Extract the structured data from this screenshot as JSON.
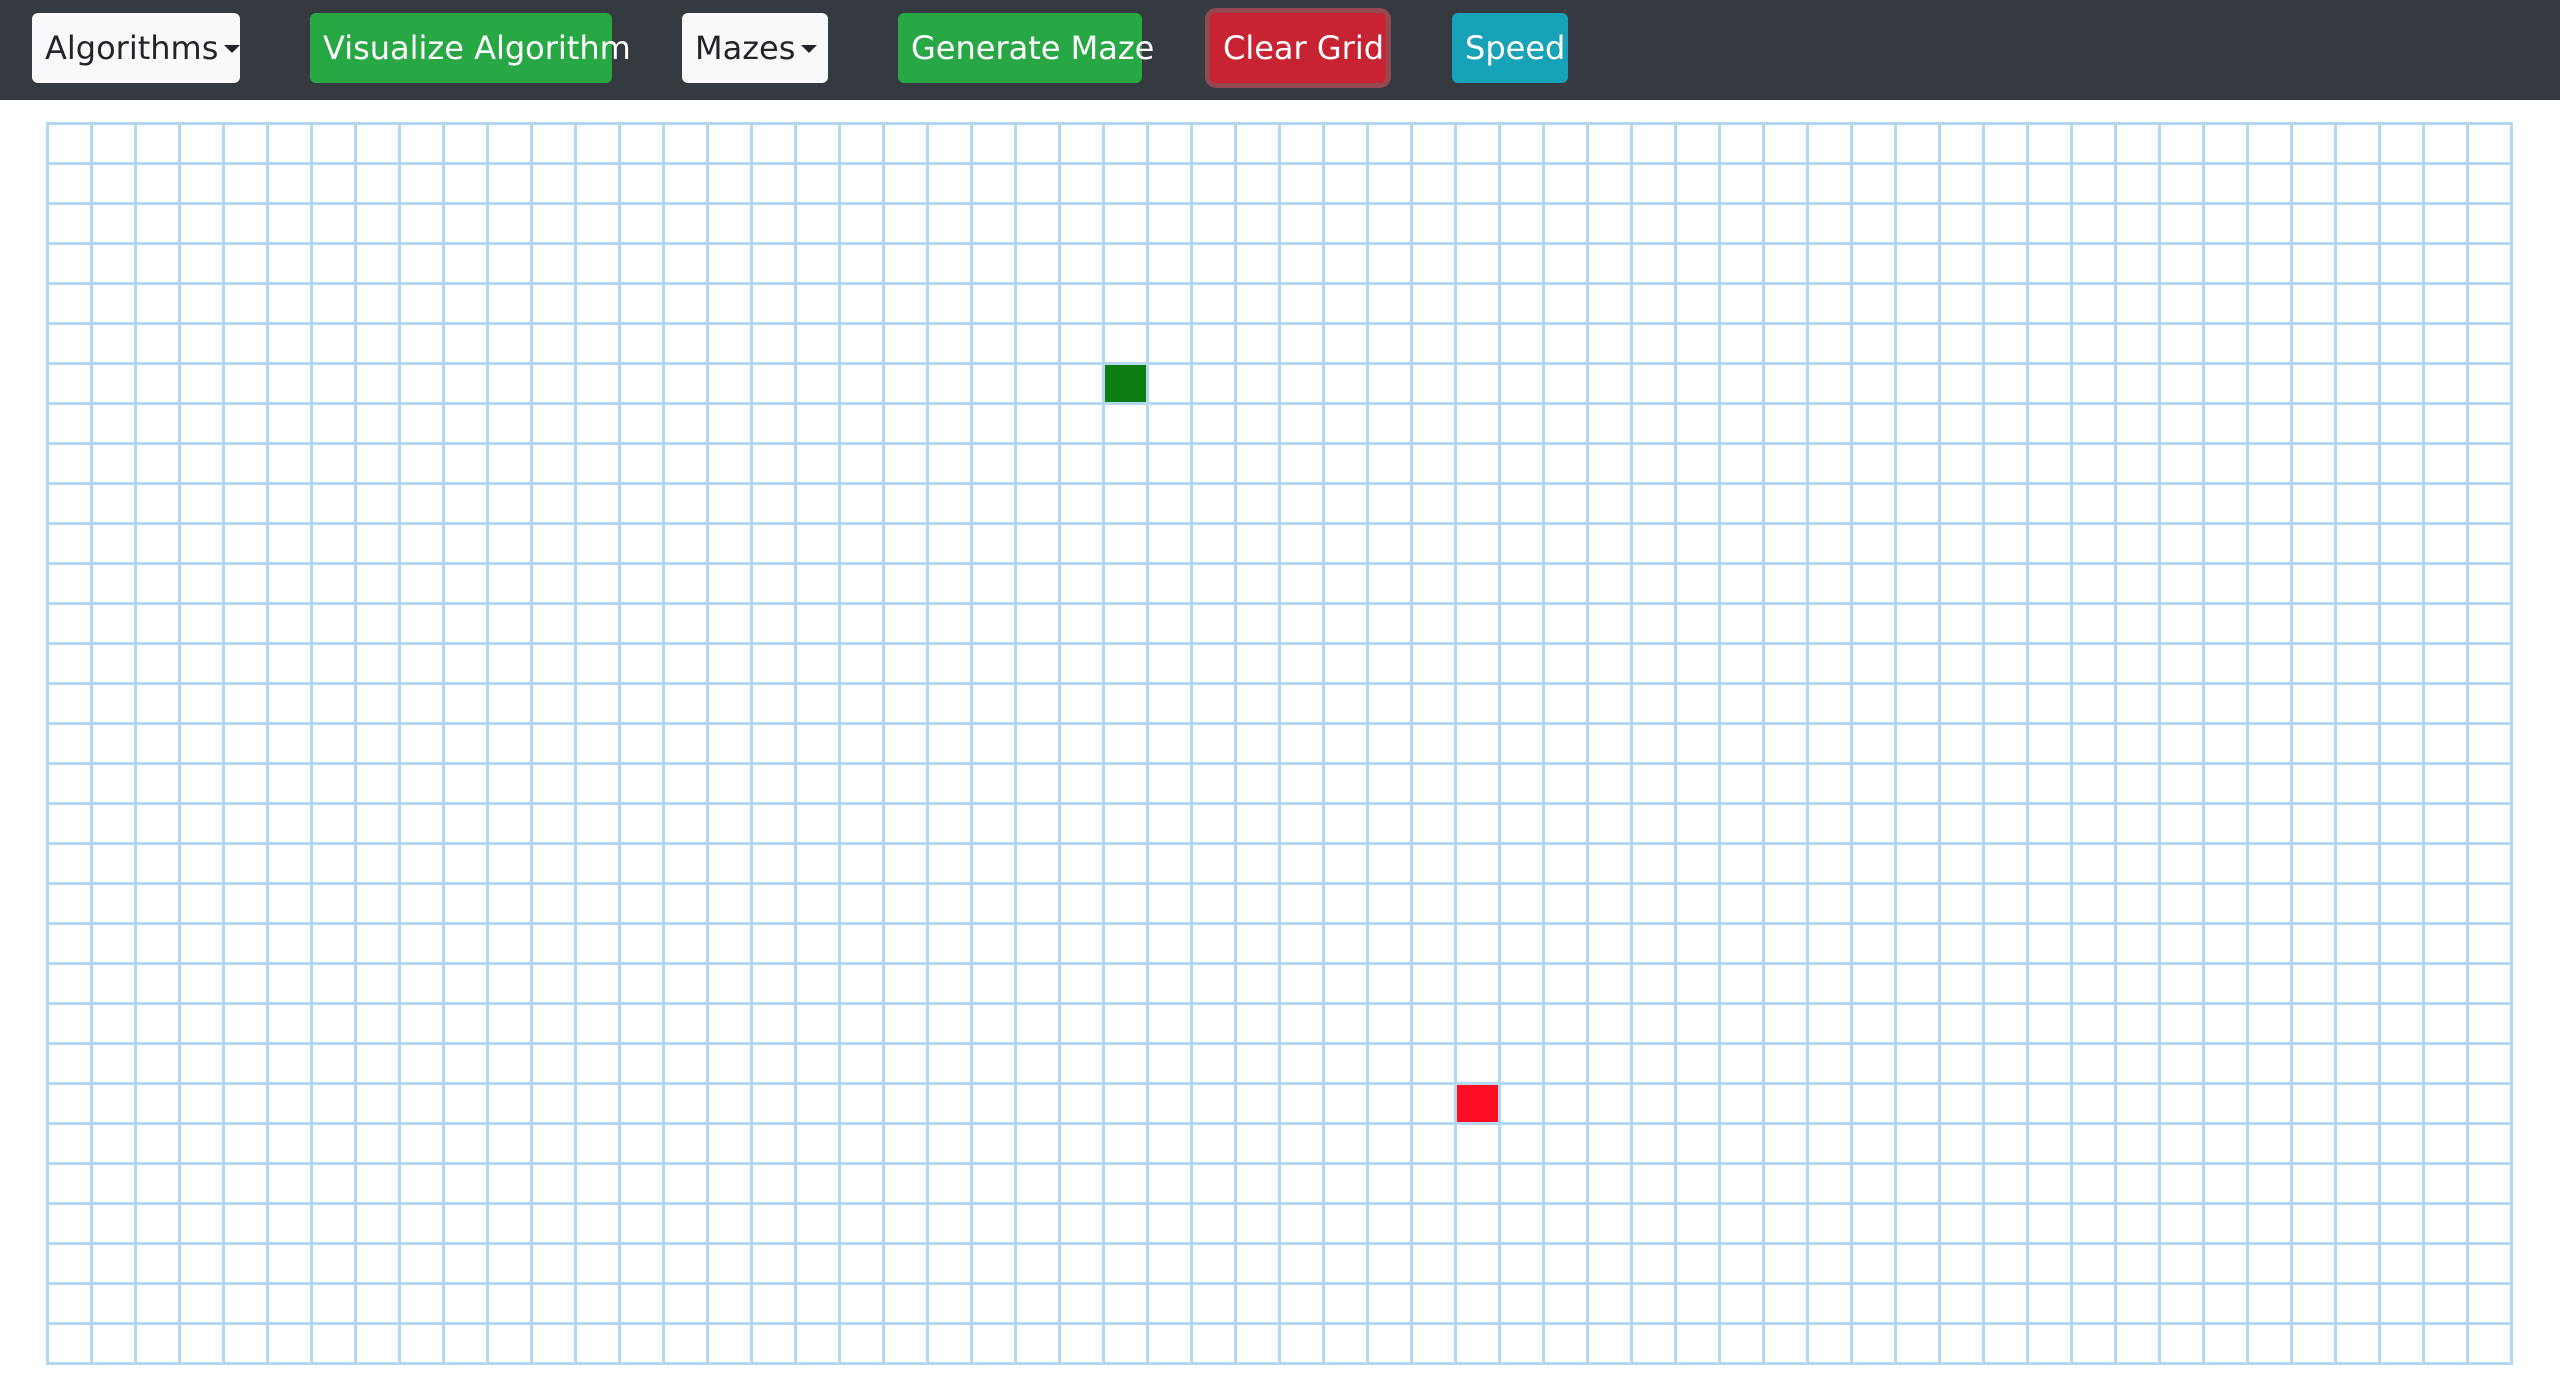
{
  "navbar": {
    "algorithms_label": "Algorithms",
    "visualize_label": "Visualize Algorithm",
    "mazes_label": "Mazes",
    "generate_maze_label": "Generate Maze",
    "clear_grid_label": "Clear Grid",
    "speed_label": "Speed"
  },
  "grid": {
    "rows": 31,
    "cols": 56,
    "start_node": {
      "row": 6,
      "col": 24
    },
    "end_node": {
      "row": 24,
      "col": 32
    },
    "line_color": "#b3d9f2",
    "start_color": "#0b7d13",
    "end_color": "#ff0d23"
  },
  "icons": {
    "dropdown": "caret-down-icon"
  }
}
